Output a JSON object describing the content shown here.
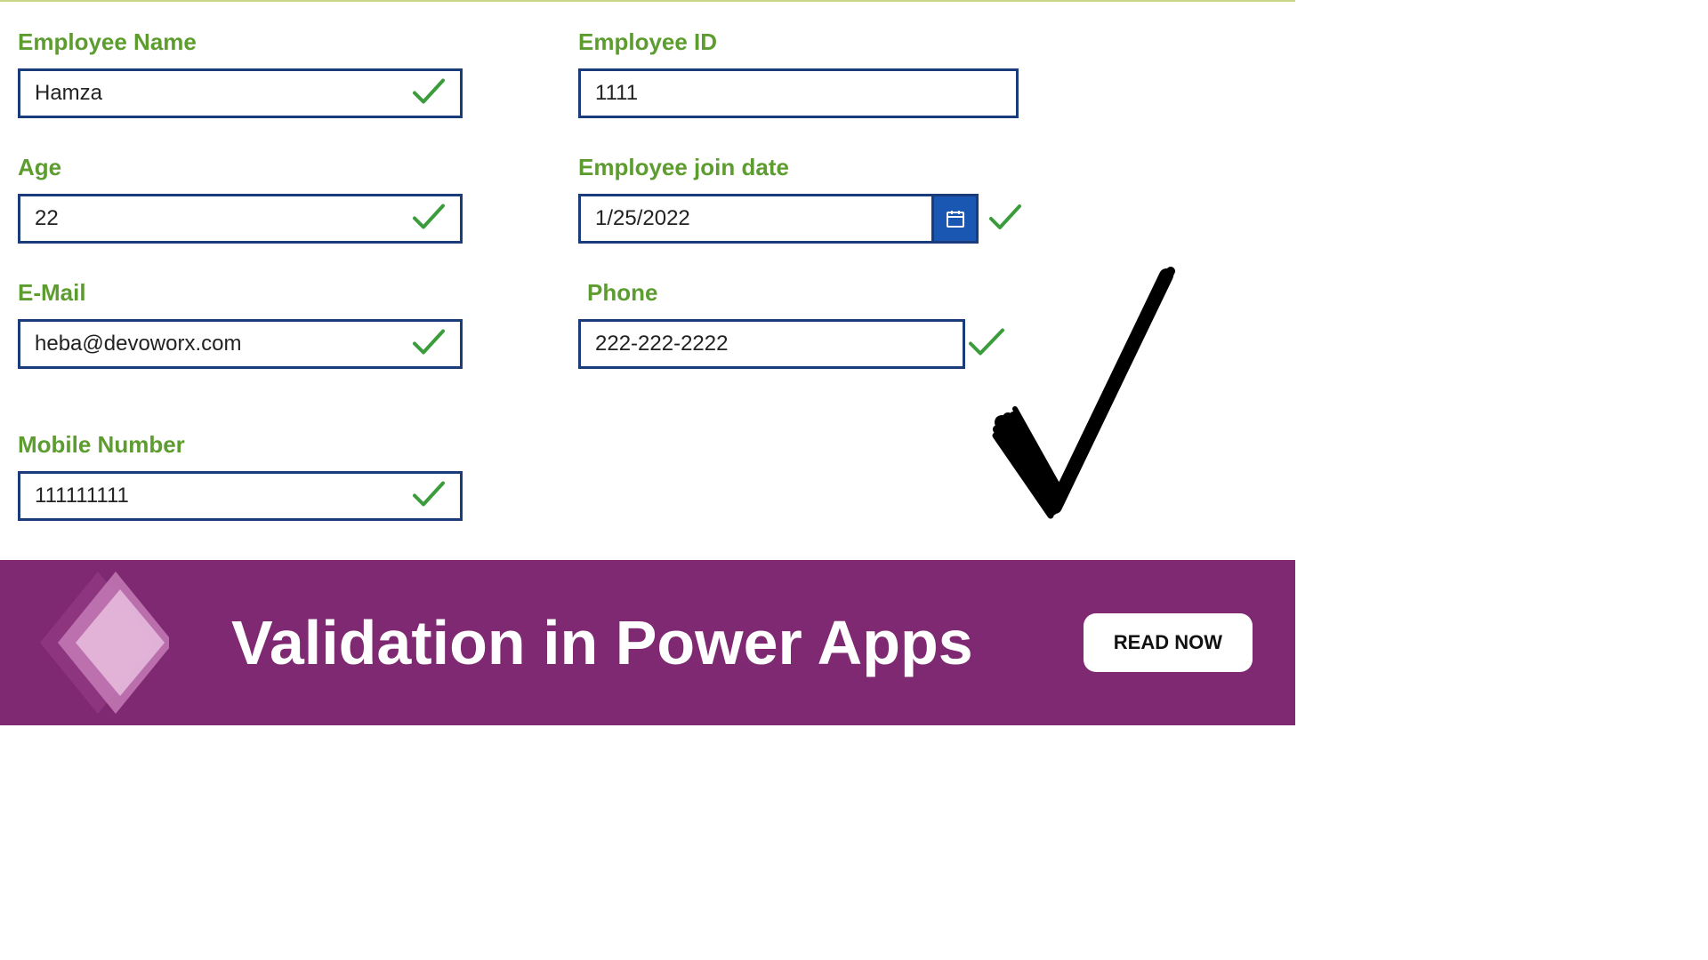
{
  "form": {
    "left": [
      {
        "label": "Employee Name",
        "value": "Hamza"
      },
      {
        "label": "Age",
        "value": "22"
      },
      {
        "label": "E-Mail",
        "value": "heba@devoworx.com"
      },
      {
        "label": "Mobile Number",
        "value": "111111111"
      }
    ],
    "right": {
      "employee_id": {
        "label": "Employee  ID",
        "value": "1111"
      },
      "join_date": {
        "label": "Employee join date",
        "value": "1/25/2022"
      },
      "phone": {
        "label": "Phone",
        "value": "222-222-2222"
      }
    }
  },
  "banner": {
    "title": "Validation in Power Apps",
    "button": "READ NOW"
  },
  "colors": {
    "label_green": "#5d9c2f",
    "input_border": "#1b3c7a",
    "check_green": "#3b9c3b",
    "banner_purple": "#7f2972",
    "calendar_blue": "#1957b3"
  }
}
